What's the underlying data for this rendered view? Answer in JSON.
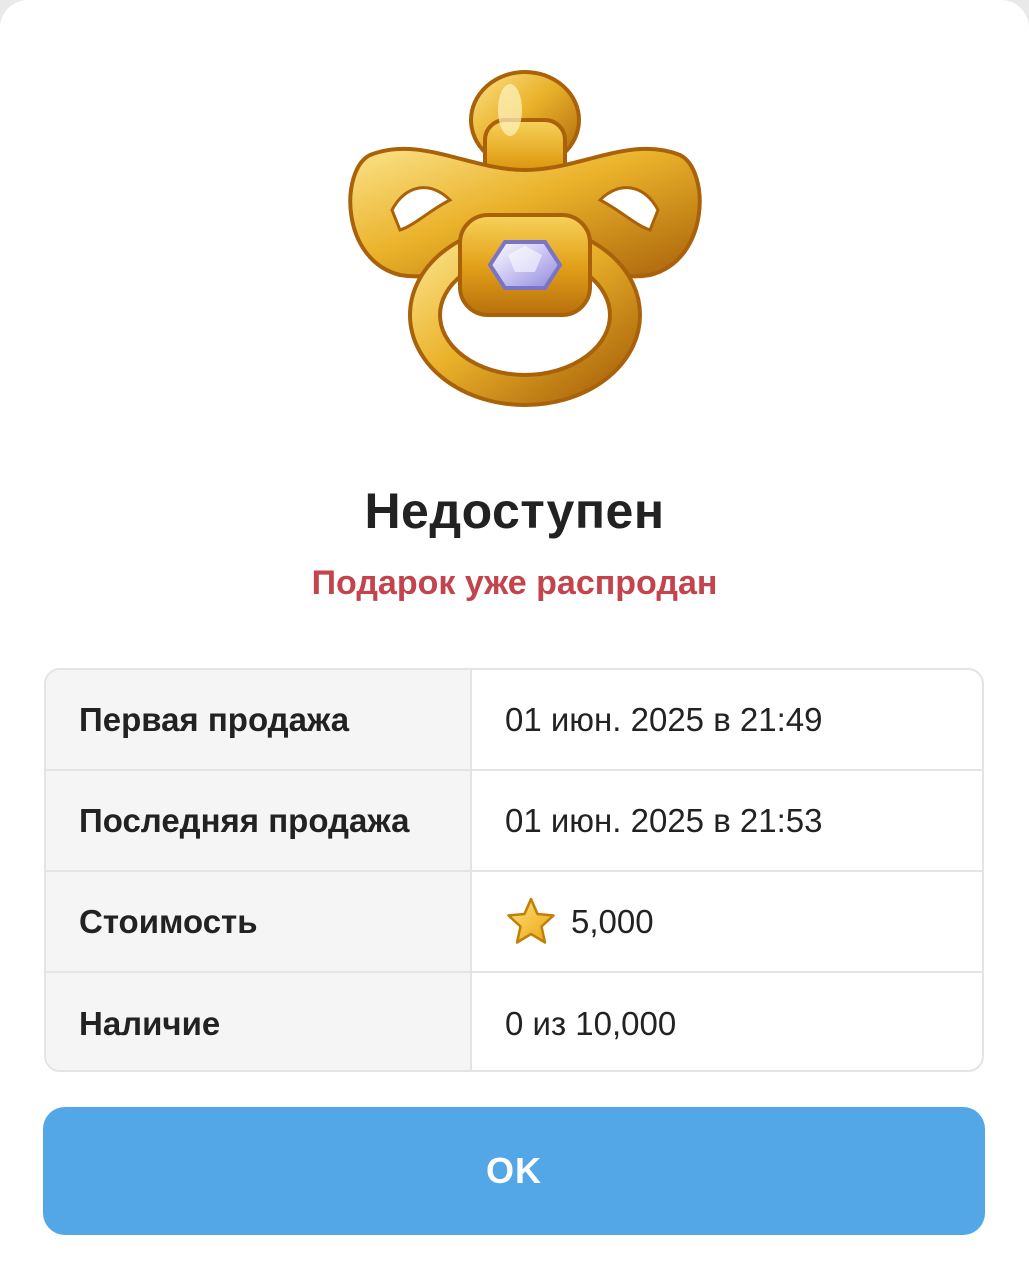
{
  "gift": {
    "icon": "golden-pacifier-with-diamond",
    "title": "Недоступен",
    "subtitle": "Подарок уже распродан"
  },
  "details": [
    {
      "label": "Первая продажа",
      "value": "01 июн. 2025 в 21:49"
    },
    {
      "label": "Последняя продажа",
      "value": "01 июн. 2025 в 21:53"
    },
    {
      "label": "Стоимость",
      "value": "5,000",
      "icon": "star-icon"
    },
    {
      "label": "Наличие",
      "value": "0 из 10,000"
    }
  ],
  "actions": {
    "ok_label": "OK"
  },
  "colors": {
    "accent": "#53a7e7",
    "status_red": "#c3444d",
    "gold": "#e7a21a"
  }
}
